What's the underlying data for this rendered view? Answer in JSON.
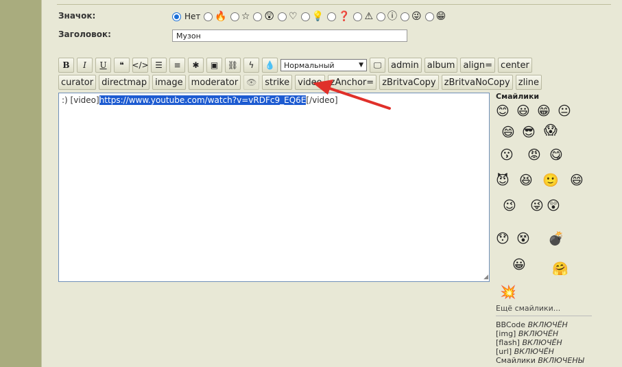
{
  "form": {
    "icon_label": "Значок:",
    "title_label": "Заголовок:",
    "title_value": "Музон",
    "icon_options": [
      {
        "label": "Нет",
        "icon": "none",
        "selected": true
      },
      {
        "label": "",
        "icon": "flame-icon",
        "glyph": "🔥"
      },
      {
        "label": "",
        "icon": "star-icon",
        "glyph": "☆"
      },
      {
        "label": "",
        "icon": "surprised-face-icon",
        "glyph": "😲"
      },
      {
        "label": "",
        "icon": "heart-icon",
        "glyph": "♡"
      },
      {
        "label": "",
        "icon": "lightbulb-icon",
        "glyph": "💡"
      },
      {
        "label": "",
        "icon": "question-icon",
        "glyph": "❓"
      },
      {
        "label": "",
        "icon": "warning-icon",
        "glyph": "⚠"
      },
      {
        "label": "",
        "icon": "info-icon",
        "glyph": "ⓘ"
      },
      {
        "label": "",
        "icon": "wink-face-icon",
        "glyph": "😜"
      },
      {
        "label": "",
        "icon": "grin-face-icon",
        "glyph": "😁"
      }
    ]
  },
  "toolbar": {
    "row1_icons": [
      {
        "name": "bold-button",
        "glyph": "B",
        "cls": "b"
      },
      {
        "name": "italic-button",
        "glyph": "I",
        "cls": "i"
      },
      {
        "name": "underline-button",
        "glyph": "U",
        "cls": "u"
      },
      {
        "name": "quote-button",
        "glyph": "❝",
        "cls": ""
      },
      {
        "name": "code-button",
        "glyph": "</>",
        "cls": ""
      },
      {
        "name": "list-button",
        "glyph": "☰",
        "cls": ""
      },
      {
        "name": "numbered-list-button",
        "glyph": "≡",
        "cls": ""
      },
      {
        "name": "asterisk-button",
        "glyph": "✱",
        "cls": ""
      },
      {
        "name": "image-button",
        "glyph": "▣",
        "cls": ""
      },
      {
        "name": "link-button",
        "glyph": "⛓",
        "cls": ""
      },
      {
        "name": "flash-button",
        "glyph": "ϟ",
        "cls": ""
      },
      {
        "name": "color-button",
        "glyph": "💧",
        "cls": ""
      }
    ],
    "size_select": "Нормальный",
    "screen_icon": "🖵",
    "row1_text": [
      "admin",
      "album",
      "align=",
      "center"
    ],
    "row2_text_a": [
      "curator",
      "directmap",
      "image",
      "moderator"
    ],
    "row2_hide_icon": "👁",
    "row2_text_b": [
      "strike",
      "video",
      "zAnchor=",
      "zBritvaCopy",
      "zBritvaNoCopy",
      "zline"
    ]
  },
  "editor": {
    "prefix": ":) [video]",
    "selected": "https://www.youtube.com/watch?v=vRDFc9_EQ6E",
    "suffix": "[/video]"
  },
  "smilies": {
    "title": "Смайлики",
    "more": "Ещё смайлики...",
    "items": [
      "😊",
      "😃",
      "😁",
      "😐",
      "😄",
      "😎",
      "😱",
      "😗",
      "😡",
      "😋",
      "😈",
      "😆",
      "🙂",
      "😄",
      "😉",
      "😜",
      "😲",
      "😯",
      "😵",
      "💣",
      "😀",
      "🤗",
      "💥"
    ]
  },
  "status": [
    {
      "key": "BBCode",
      "value": "ВКЛЮЧЁН"
    },
    {
      "key": "[img]",
      "value": "ВКЛЮЧЁН"
    },
    {
      "key": "[flash]",
      "value": "ВКЛЮЧЁН"
    },
    {
      "key": "[url]",
      "value": "ВКЛЮЧЁН"
    },
    {
      "key": "Смайлики",
      "value": "ВКЛЮЧЕНЫ"
    }
  ],
  "colors": {
    "accent": "#1a6fd8",
    "selection": "#1d5bd1",
    "arrow": "#e0302a"
  }
}
